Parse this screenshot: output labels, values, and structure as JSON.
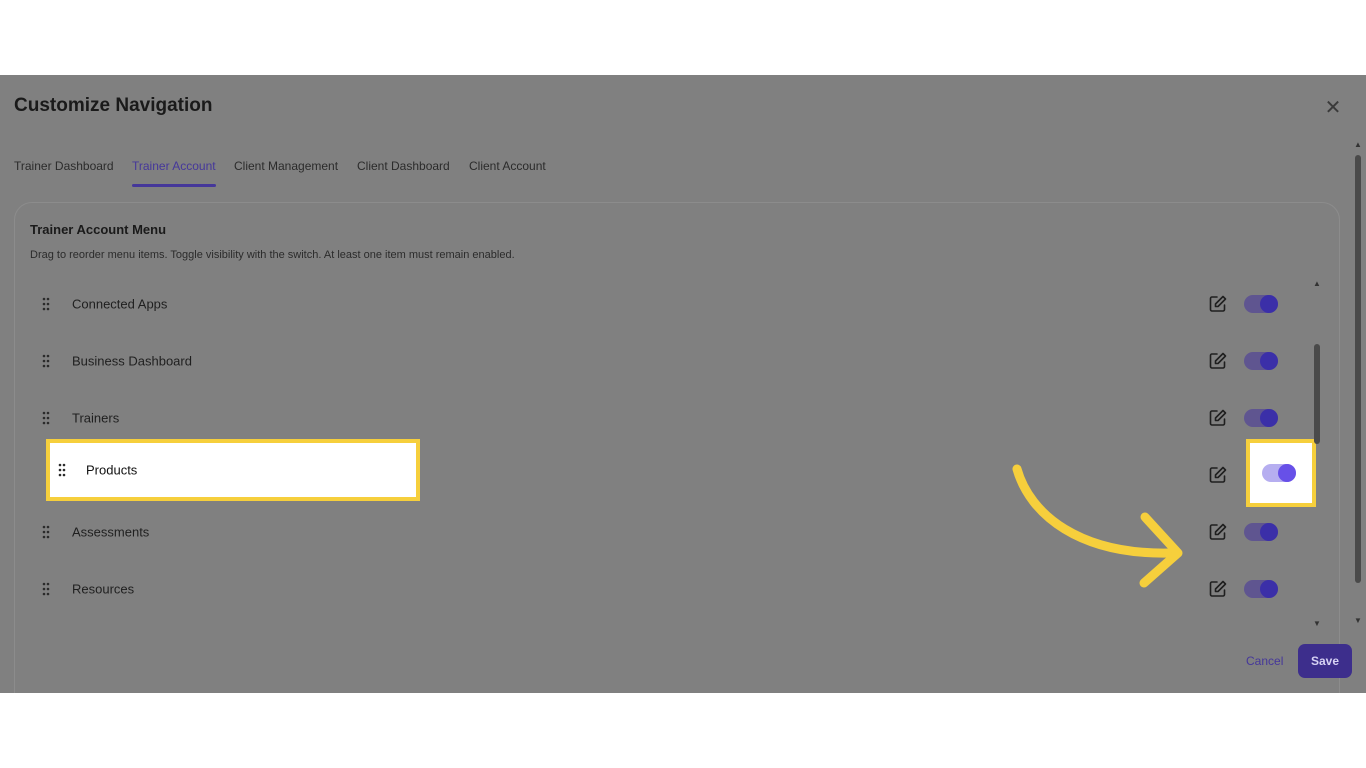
{
  "modal": {
    "title": "Customize Navigation",
    "close_icon": "close-icon"
  },
  "tabs": [
    {
      "label": "Trainer Dashboard",
      "active": false
    },
    {
      "label": "Trainer Account",
      "active": true
    },
    {
      "label": "Client Management",
      "active": false
    },
    {
      "label": "Client Dashboard",
      "active": false
    },
    {
      "label": "Client Account",
      "active": false
    }
  ],
  "panel": {
    "title": "Trainer Account Menu",
    "description": "Drag to reorder menu items. Toggle visibility with the switch. At least one item must remain enabled."
  },
  "menu_items": [
    {
      "label": "Connected Apps",
      "enabled": true
    },
    {
      "label": "Business Dashboard",
      "enabled": true
    },
    {
      "label": "Trainers",
      "enabled": true
    },
    {
      "label": "Products",
      "enabled": true
    },
    {
      "label": "Assessments",
      "enabled": true
    },
    {
      "label": "Resources",
      "enabled": true
    }
  ],
  "footer": {
    "cancel_label": "Cancel",
    "save_label": "Save"
  },
  "colors": {
    "accent": "#45379a",
    "highlight": "#f6cf3c",
    "overlay": "#808080"
  }
}
